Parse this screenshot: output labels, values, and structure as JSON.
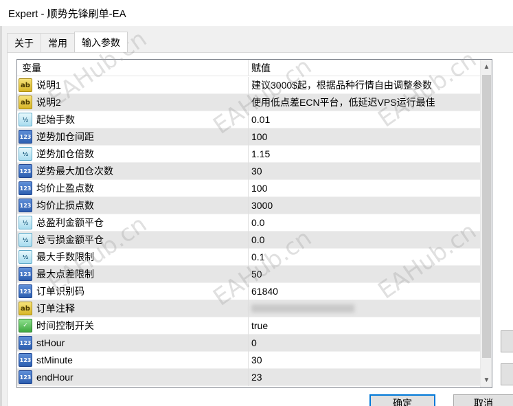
{
  "window": {
    "title": "Expert - 顺势先锋刷单-EA"
  },
  "tabs": [
    {
      "label": "关于"
    },
    {
      "label": "常用"
    },
    {
      "label": "输入参数"
    }
  ],
  "grid": {
    "headers": {
      "variable": "变量",
      "value": "赋值"
    },
    "rows": [
      {
        "type": "str",
        "icon_text": "ab",
        "name": "说明1",
        "value": "建议3000$起，根据品种行情自由调整参数"
      },
      {
        "type": "str",
        "icon_text": "ab",
        "name": "说明2",
        "value": "使用低点差ECN平台，低延迟VPS运行最佳"
      },
      {
        "type": "dbl",
        "icon_text": "½",
        "name": "起始手数",
        "value": "0.01"
      },
      {
        "type": "int",
        "icon_text": "123",
        "name": "逆势加仓间距",
        "value": "100"
      },
      {
        "type": "dbl",
        "icon_text": "½",
        "name": "逆势加仓倍数",
        "value": "1.15"
      },
      {
        "type": "int",
        "icon_text": "123",
        "name": "逆势最大加仓次数",
        "value": "30"
      },
      {
        "type": "int",
        "icon_text": "123",
        "name": "均价止盈点数",
        "value": "100"
      },
      {
        "type": "int",
        "icon_text": "123",
        "name": "均价止损点数",
        "value": "3000"
      },
      {
        "type": "dbl",
        "icon_text": "½",
        "name": "总盈利金额平仓",
        "value": "0.0"
      },
      {
        "type": "dbl",
        "icon_text": "½",
        "name": "总亏损金额平仓",
        "value": "0.0"
      },
      {
        "type": "dbl",
        "icon_text": "½",
        "name": "最大手数限制",
        "value": "0.1"
      },
      {
        "type": "int",
        "icon_text": "123",
        "name": "最大点差限制",
        "value": "50"
      },
      {
        "type": "int",
        "icon_text": "123",
        "name": "订单识别码",
        "value": "61840"
      },
      {
        "type": "str",
        "icon_text": "ab",
        "name": "订单注释",
        "value": ""
      },
      {
        "type": "bool",
        "icon_text": "✓",
        "name": "时间控制开关",
        "value": "true"
      },
      {
        "type": "int",
        "icon_text": "123",
        "name": "stHour",
        "value": "0"
      },
      {
        "type": "int",
        "icon_text": "123",
        "name": "stMinute",
        "value": "30"
      },
      {
        "type": "int",
        "icon_text": "123",
        "name": "endHour",
        "value": "23"
      }
    ]
  },
  "buttons": {
    "ok": "确定",
    "cancel": "取消"
  },
  "watermark": "EAHub.cn",
  "colors": {
    "accent": "#0078d7",
    "row_alt": "#e6e6e6",
    "border": "#828790"
  }
}
